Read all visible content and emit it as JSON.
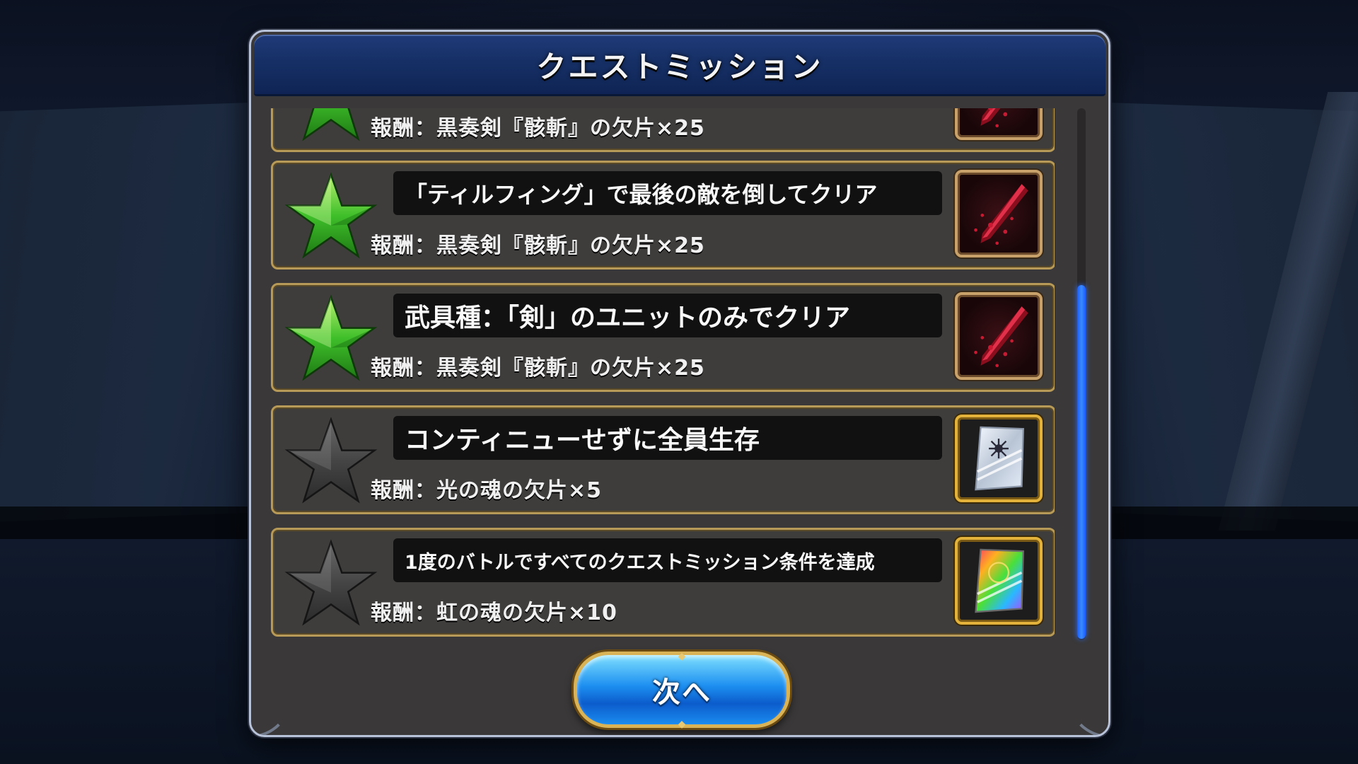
{
  "modal": {
    "title": "クエストミッション",
    "next_label": "次へ"
  },
  "missions": [
    {
      "condition": "",
      "reward": "報酬：黒奏剣『骸斬』の欠片×25",
      "achieved": true,
      "item_icon": "black-sword-fragment-icon",
      "partially_visible": true
    },
    {
      "condition": "「ティルフィング」で最後の敵を倒してクリア",
      "reward": "報酬：黒奏剣『骸斬』の欠片×25",
      "achieved": true,
      "item_icon": "black-sword-fragment-icon"
    },
    {
      "condition": "武具種：「剣」のユニットのみでクリア",
      "reward": "報酬：黒奏剣『骸斬』の欠片×25",
      "achieved": true,
      "item_icon": "black-sword-fragment-icon"
    },
    {
      "condition": "コンティニューせずに全員生存",
      "reward": "報酬：光の魂の欠片×5",
      "achieved": false,
      "item_icon": "light-soul-fragment-icon"
    },
    {
      "condition": "1度のバトルですべてのクエストミッション条件を達成",
      "reward": "報酬：虹の魂の欠片×10",
      "achieved": false,
      "item_icon": "rainbow-soul-fragment-icon"
    }
  ],
  "colors": {
    "achieved_star": "#3fbf2a",
    "unachieved_star": "#4a4a4a",
    "header_blue": "#163066",
    "scroll_thumb": "#2a7cff",
    "frame_gold": "#b89a58"
  }
}
